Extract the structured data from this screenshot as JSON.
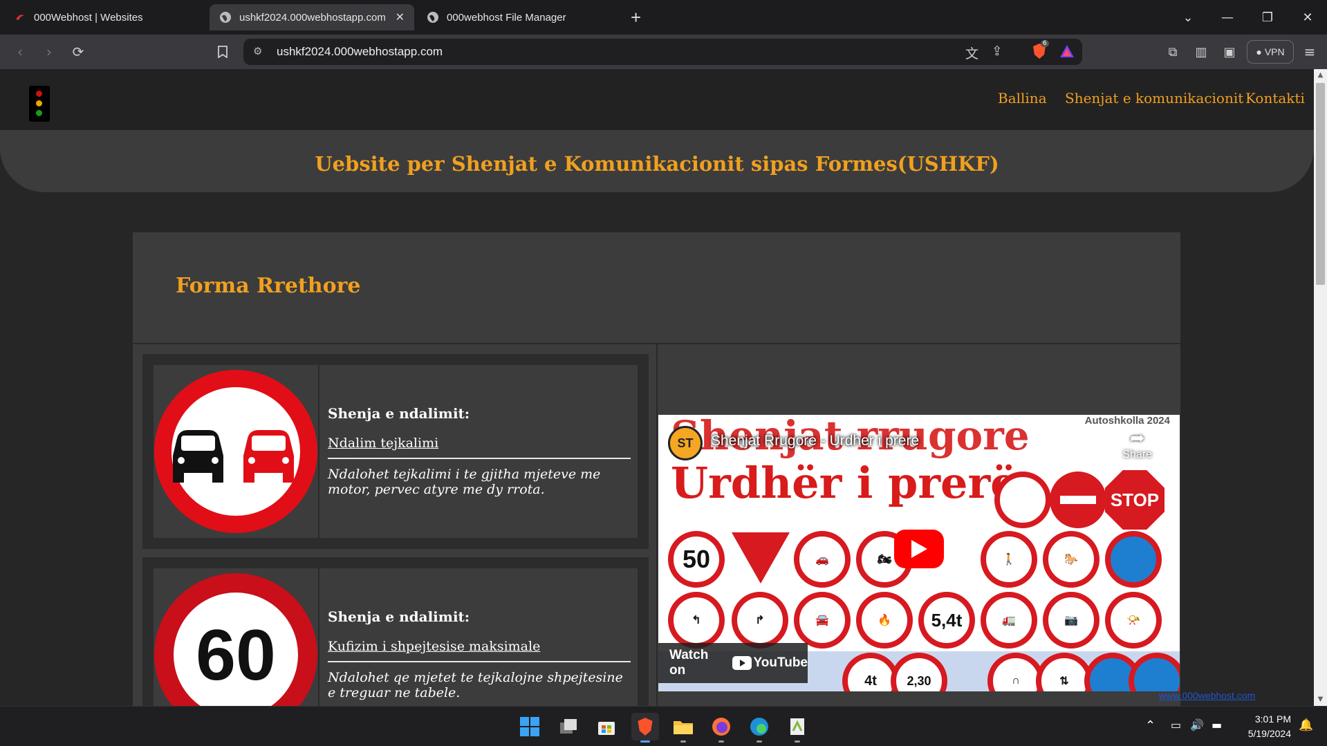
{
  "browser": {
    "tabs": [
      {
        "title": "000Webhost | Websites",
        "active": false
      },
      {
        "title": "ushkf2024.000webhostapp.com",
        "active": true
      },
      {
        "title": "000webhost File Manager",
        "active": false
      }
    ],
    "url": "ushkf2024.000webhostapp.com",
    "vpn_label": "VPN",
    "shields_count": "6"
  },
  "site": {
    "nav": [
      "Ballina",
      "Shenjat e komunikacionit",
      "Kontakti"
    ],
    "banner_title": "Uebsite per Shenjat e Komunikacionit sipas Formes(USHKF)",
    "section_title": "Forma Rrethore",
    "cards": [
      {
        "kind": "Shenja e ndalimit:",
        "name": "Ndalim tejkalimi",
        "description": "Ndalohet tejkalimi i te gjitha mjeteve me motor, pervec atyre me dy rrota."
      },
      {
        "kind": "Shenja e ndalimit:",
        "name": "Kufizim i shpejtesise maksimale",
        "description": "Ndalohet qe mjetet te tejkalojne shpejtesine e treguar ne tabele.",
        "sign_text": "60"
      }
    ],
    "video": {
      "title": "Shenjat Rrugore - Urdher i prere",
      "thumb_line1": "Shenjat rrugore",
      "thumb_line2": "Urdhër i prerë",
      "thumb_corner": "Autoshkolla 2024",
      "channel_badge": "ST",
      "share_label": "Share",
      "watch_on": "Watch on",
      "youtube": "YouTube",
      "thumb_signs": [
        "50",
        "5,4t",
        "4t",
        "2,30",
        "STOP"
      ]
    },
    "host_badge": "www.000webhost.com"
  },
  "taskbar": {
    "time": "3:01 PM",
    "date": "5/19/2024"
  }
}
